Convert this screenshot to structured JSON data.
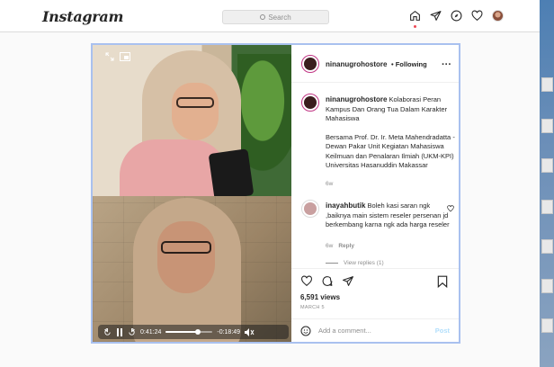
{
  "nav": {
    "logo": "Instagram",
    "search_placeholder": "Search",
    "icons": [
      "home-icon",
      "direct-icon",
      "explore-icon",
      "heart-icon",
      "profile-avatar"
    ]
  },
  "post": {
    "username": "ninanugrohostore",
    "following_label": "• Following",
    "caption_line1": "Kolaborasi Peran Kampus Dan Orang Tua Dalam Karakter Mahasiswa",
    "caption_line2": "Bersama Prof. Dr. Ir. Meta Mahendradatta - Dewan Pakar Unit Kegiatan Mahasiswa Keilmuan dan Penalaran Ilmiah (UKM-KPI) Universitas Hasanuddin Makassar",
    "caption_age": "6w",
    "comment": {
      "username": "inayahbutik",
      "text": "Boleh kasi saran ngk ,baiknya main sistem reseler persenan jd berkembang karna ngk ada harga reseler",
      "age": "6w",
      "reply_label": "Reply",
      "view_replies": "View replies (1)"
    },
    "views": "6,591 views",
    "date": "MARCH 5",
    "add_comment_placeholder": "Add a comment...",
    "post_label": "Post"
  },
  "video": {
    "elapsed": "0:41:24",
    "remaining": "-0:18:49",
    "progress": 0.69
  },
  "colors": {
    "accent": "#0095f6",
    "post_disabled": "#b2dffc",
    "card_border": "#a9c1ef"
  }
}
